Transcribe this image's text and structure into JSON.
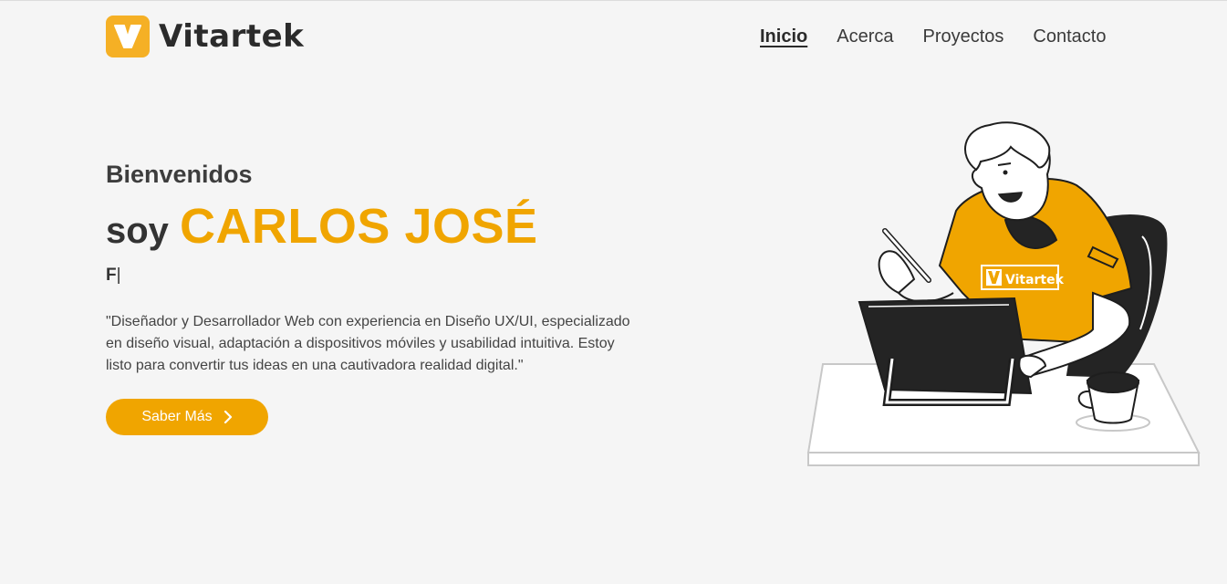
{
  "header": {
    "logo_text": "Vitartek",
    "logo_mark_letter": "V",
    "nav": [
      {
        "label": "Inicio",
        "active": true
      },
      {
        "label": "Acerca",
        "active": false
      },
      {
        "label": "Proyectos",
        "active": false
      },
      {
        "label": "Contacto",
        "active": false
      }
    ]
  },
  "hero": {
    "greeting": "Bienvenidos",
    "intro": "soy",
    "name": "CARLOS JOSÉ",
    "typed_text": "F",
    "cursor": "|",
    "description": "\"Diseñador y Desarrollador Web con experiencia en Diseño UX/UI, especializado en diseño visual, adaptación a dispositivos móviles y usabilidad intuitiva. Estoy listo para convertir tus ideas en una cautivadora realidad digital.\"",
    "cta_label": "Saber Más",
    "cta_icon": "chevron-right-icon"
  },
  "illustration": {
    "shirt_logo_text": "Vitartek",
    "shirt_logo_letter": "V"
  },
  "colors": {
    "accent": "#f0a500",
    "background": "#f5f5f5",
    "text": "#333333"
  }
}
